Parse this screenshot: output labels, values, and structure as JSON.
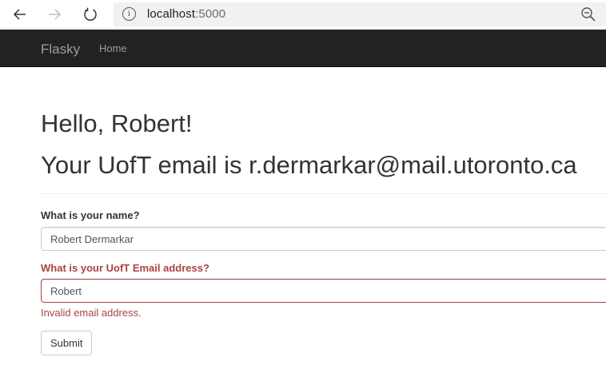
{
  "browser": {
    "url_host": "localhost",
    "url_port": ":5000",
    "icons": {
      "back": "back-arrow-icon",
      "forward": "forward-arrow-icon",
      "reload": "reload-icon",
      "info": "info-icon",
      "zoom": "zoom-out-icon"
    }
  },
  "navbar": {
    "brand": "Flasky",
    "links": [
      {
        "label": "Home"
      }
    ]
  },
  "main": {
    "greeting": "Hello, Robert!",
    "email_line": "Your UofT email is r.dermarkar@mail.utoronto.ca",
    "form": {
      "name_label": "What is your name?",
      "name_value": "Robert Dermarkar",
      "email_label": "What is your UofT Email address?",
      "email_value": "Robert",
      "email_error": "Invalid email address.",
      "submit_label": "Submit"
    }
  },
  "colors": {
    "navbar_bg": "#222222",
    "navbar_text": "#9d9d9d",
    "error": "#a94442",
    "text": "#333333"
  }
}
